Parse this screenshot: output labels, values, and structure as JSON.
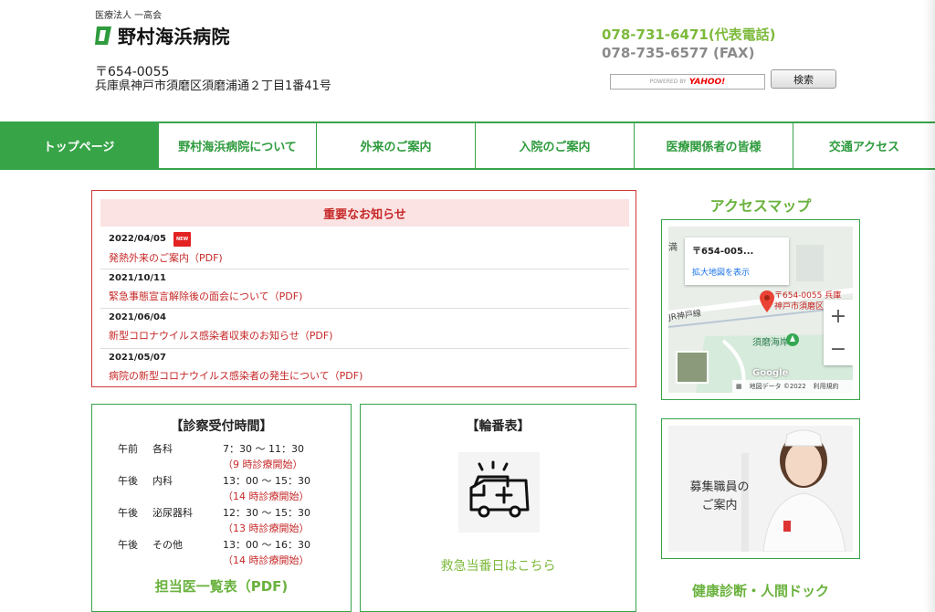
{
  "header": {
    "corporation": "医療法人 一高会",
    "hospital_name": "野村海浜病院",
    "postal_code": "〒654-0055",
    "address": "兵庫県神戸市須磨区須磨浦通２丁目1番41号",
    "tel": "078-731-6471(代表電話)",
    "fax": "078-735-6577 (FAX)",
    "search": {
      "powered_by": "POWERED BY",
      "yahoo": "YAHOO!",
      "button_label": "検索"
    }
  },
  "nav": {
    "items": [
      {
        "label": "トップページ"
      },
      {
        "label": "野村海浜病院について"
      },
      {
        "label": "外来のご案内"
      },
      {
        "label": "入院のご案内"
      },
      {
        "label": "医療関係者の皆様"
      },
      {
        "label": "交通アクセス"
      }
    ]
  },
  "notice": {
    "title": "重要なお知らせ",
    "new_badge": "NEW",
    "items": [
      {
        "date": "2022/04/05",
        "text": "発熱外来のご案内（PDF)"
      },
      {
        "date": "2021/10/11",
        "text": "緊急事態宣言解除後の面会について（PDF)"
      },
      {
        "date": "2021/06/04",
        "text": "新型コロナウイルス感染者収束のお知らせ（PDF)"
      },
      {
        "date": "2021/05/07",
        "text": "病院の新型コロナウイルス感染者の発生について（PDF)"
      }
    ]
  },
  "access": {
    "title": "アクセスマップ",
    "card_title": "〒654-005...",
    "card_link": "拡大地図を表示",
    "pin_label_1": "〒654-0055 兵庫",
    "pin_label_2": "神戸市須磨区須",
    "station_label": "JR神戸線",
    "beach_label": "須磨海岸",
    "side_label": "満",
    "google": "Google",
    "map_data": "地図データ ©2022",
    "terms": "利用規約",
    "zoom_in": "+",
    "zoom_out": "−"
  },
  "hours": {
    "title": "【診察受付時間】",
    "rows": [
      {
        "period": "午前",
        "dept": "各科",
        "time": "7：30 ～ 11：30",
        "note": "（9 時診療開始）"
      },
      {
        "period": "午後",
        "dept": "内科",
        "time": "13：00 ～ 15：30",
        "note": "（14 時診療開始）"
      },
      {
        "period": "午後",
        "dept": "泌尿器科",
        "time": "12：30 ～ 15：30",
        "note": "（13 時診療開始）"
      },
      {
        "period": "午後",
        "dept": "その他",
        "time": "13：00 ～ 16：30",
        "note": "（14 時診療開始）"
      }
    ],
    "doctor_link": "担当医一覧表（PDF)"
  },
  "emergency": {
    "title": "【輪番表】",
    "link": "救急当番日はこちら"
  },
  "recruit": {
    "line1": "募集職員の",
    "line2": "ご案内"
  },
  "checkup": {
    "title": "健康診断・人間ドック"
  },
  "colors": {
    "green": "#38a44a",
    "light_green": "#7dba3c",
    "red": "#c62828"
  }
}
